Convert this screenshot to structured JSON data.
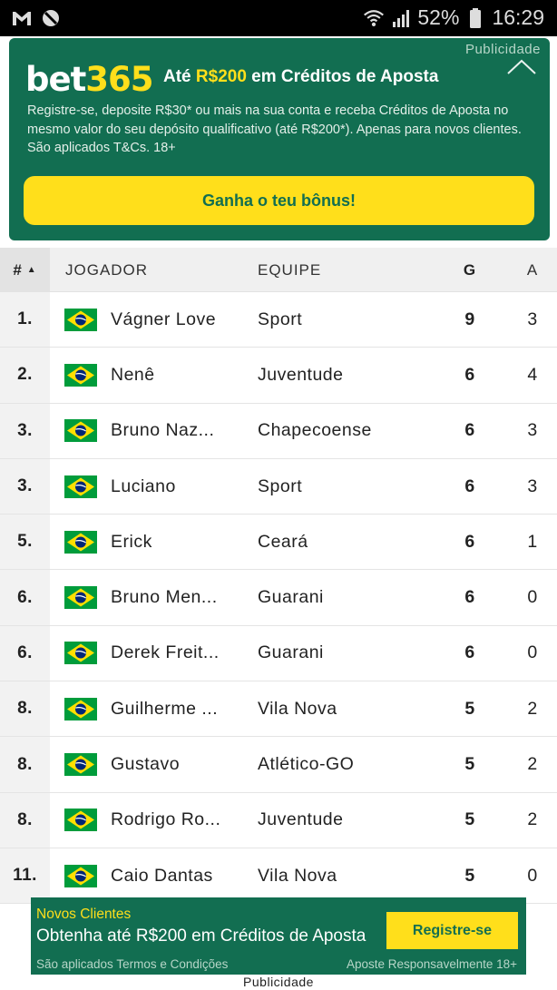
{
  "status_bar": {
    "battery": "52%",
    "time": "16:29",
    "icons": [
      "gmail-icon",
      "no-disturb-icon",
      "wifi-icon",
      "signal-icon",
      "battery-icon"
    ]
  },
  "ad_top": {
    "label": "Publicidade",
    "logo_bet": "bet",
    "logo_365": "365",
    "headline_pre": "Até ",
    "headline_amount": "R$200",
    "headline_post": " em Créditos de Aposta",
    "body": "Registre-se, deposite R$30* ou mais na sua conta e receba Créditos de Aposta no mesmo valor do seu depósito qualificativo (até R$200*). Apenas para novos clientes. São aplicados T&Cs. 18+",
    "cta": "Ganha o teu bônus!"
  },
  "table": {
    "headers": {
      "rank": "#",
      "player": "JOGADOR",
      "team": "EQUIPE",
      "goals": "G",
      "assists": "A"
    },
    "rows": [
      {
        "rank": "1.",
        "player": "Vágner Love",
        "team": "Sport",
        "goals": "9",
        "assists": "3"
      },
      {
        "rank": "2.",
        "player": "Nenê",
        "team": "Juventude",
        "goals": "6",
        "assists": "4"
      },
      {
        "rank": "3.",
        "player": "Bruno Naz...",
        "team": "Chapecoense",
        "goals": "6",
        "assists": "3"
      },
      {
        "rank": "3.",
        "player": "Luciano",
        "team": "Sport",
        "goals": "6",
        "assists": "3"
      },
      {
        "rank": "5.",
        "player": "Erick",
        "team": "Ceará",
        "goals": "6",
        "assists": "1"
      },
      {
        "rank": "6.",
        "player": "Bruno Men...",
        "team": "Guarani",
        "goals": "6",
        "assists": "0"
      },
      {
        "rank": "6.",
        "player": "Derek Freit...",
        "team": "Guarani",
        "goals": "6",
        "assists": "0"
      },
      {
        "rank": "8.",
        "player": "Guilherme ...",
        "team": "Vila Nova",
        "goals": "5",
        "assists": "2"
      },
      {
        "rank": "8.",
        "player": "Gustavo",
        "team": "Atlético-GO",
        "goals": "5",
        "assists": "2"
      },
      {
        "rank": "8.",
        "player": "Rodrigo Ro...",
        "team": "Juventude",
        "goals": "5",
        "assists": "2"
      },
      {
        "rank": "11.",
        "player": "Caio Dantas",
        "team": "Vila Nova",
        "goals": "5",
        "assists": "0"
      }
    ]
  },
  "ad_bottom": {
    "kicker": "Novos Clientes",
    "headline": "Obtenha até R$200 em Créditos de Aposta",
    "button": "Registre-se",
    "terms": "São aplicados Termos e Condições",
    "responsible": "Aposte Responsavelmente  18+",
    "label": "Publicidade"
  },
  "colors": {
    "brand_green": "#126e51",
    "brand_yellow": "#ffdf1b",
    "flag_green": "#009c3b",
    "flag_yellow": "#ffdf00",
    "flag_blue": "#002776"
  }
}
